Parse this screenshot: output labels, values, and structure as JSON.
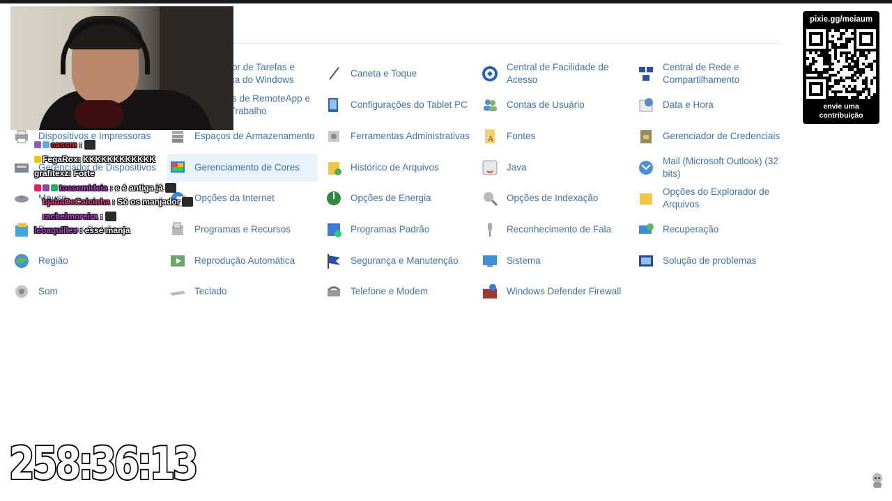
{
  "control_panel": {
    "items": [
      {
        "label": "Dispositivos e Impressoras",
        "icon": "printer-icon",
        "col": 0,
        "row": 2
      },
      {
        "label": "Gerenciador de Dispositivos",
        "icon": "device-manager-icon",
        "col": 0,
        "row": 3
      },
      {
        "label": "Mouse",
        "icon": "mouse-icon",
        "col": 0,
        "row": 4
      },
      {
        "label": "Programas Padrão",
        "icon": "folder-icon",
        "col": 0,
        "row": 5
      },
      {
        "label": "Região",
        "icon": "globe-clock-icon",
        "col": 0,
        "row": 6
      },
      {
        "label": "Som",
        "icon": "speaker-icon",
        "col": 0,
        "row": 7
      },
      {
        "label": "Agendador de Tarefas e Segurança do Windows",
        "icon": "task-icon",
        "col": 1,
        "row": 0
      },
      {
        "label": "Conexões de RemoteApp e Área de Trabalho",
        "icon": "remote-icon",
        "col": 1,
        "row": 1
      },
      {
        "label": "Espaços de Armazenamento",
        "icon": "storage-icon",
        "col": 1,
        "row": 2
      },
      {
        "label": "Gerenciamento de Cores",
        "icon": "color-management-icon",
        "col": 1,
        "row": 3,
        "highlight": true
      },
      {
        "label": "Opções da Internet",
        "icon": "internet-options-icon",
        "col": 1,
        "row": 4
      },
      {
        "label": "Programas e Recursos",
        "icon": "programs-icon",
        "col": 1,
        "row": 5
      },
      {
        "label": "Reprodução Automática",
        "icon": "autoplay-icon",
        "col": 1,
        "row": 6
      },
      {
        "label": "Teclado",
        "icon": "keyboard-icon",
        "col": 1,
        "row": 7
      },
      {
        "label": "Caneta e Toque",
        "icon": "pen-icon",
        "col": 2,
        "row": 0
      },
      {
        "label": "Configurações do Tablet PC",
        "icon": "tablet-icon",
        "col": 2,
        "row": 1
      },
      {
        "label": "Ferramentas Administrativas",
        "icon": "admin-tools-icon",
        "col": 2,
        "row": 2
      },
      {
        "label": "Histórico de Arquivos",
        "icon": "file-history-icon",
        "col": 2,
        "row": 3
      },
      {
        "label": "Opções de Energia",
        "icon": "power-icon",
        "col": 2,
        "row": 4
      },
      {
        "label": "Programas Padrão",
        "icon": "default-programs-icon",
        "col": 2,
        "row": 5
      },
      {
        "label": "Segurança e Manutenção",
        "icon": "flag-icon",
        "col": 2,
        "row": 6
      },
      {
        "label": "Telefone e Modem",
        "icon": "phone-icon",
        "col": 2,
        "row": 7
      },
      {
        "label": "Central de Facilidade de Acesso",
        "icon": "ease-of-access-icon",
        "col": 3,
        "row": 0
      },
      {
        "label": "Contas de Usuário",
        "icon": "users-icon",
        "col": 3,
        "row": 1
      },
      {
        "label": "Fontes",
        "icon": "fonts-icon",
        "col": 3,
        "row": 2
      },
      {
        "label": "Java",
        "icon": "java-icon",
        "col": 3,
        "row": 3
      },
      {
        "label": "Opções de Indexação",
        "icon": "indexing-icon",
        "col": 3,
        "row": 4
      },
      {
        "label": "Reconhecimento de Fala",
        "icon": "microphone-icon",
        "col": 3,
        "row": 5
      },
      {
        "label": "Sistema",
        "icon": "system-icon",
        "col": 3,
        "row": 6
      },
      {
        "label": "Windows Defender Firewall",
        "icon": "firewall-icon",
        "col": 3,
        "row": 7
      },
      {
        "label": "Central de Rede e Compartilhamento",
        "icon": "network-icon",
        "col": 4,
        "row": 0
      },
      {
        "label": "Data e Hora",
        "icon": "calendar-icon",
        "col": 4,
        "row": 1
      },
      {
        "label": "Gerenciador de Credenciais",
        "icon": "credentials-icon",
        "col": 4,
        "row": 2
      },
      {
        "label": "Mail (Microsoft Outlook) (32 bits)",
        "icon": "mail-icon",
        "col": 4,
        "row": 3
      },
      {
        "label": "Opções do Explorador de Arquivos",
        "icon": "explorer-options-icon",
        "col": 4,
        "row": 4
      },
      {
        "label": "Recuperação",
        "icon": "recovery-icon",
        "col": 4,
        "row": 5
      },
      {
        "label": "Solução de problemas",
        "icon": "troubleshoot-icon",
        "col": 4,
        "row": 6
      }
    ]
  },
  "chat": [
    {
      "user": "cassm",
      "user_color": "#e8323c",
      "sep": " :",
      "text": "",
      "badge_colors": [
        "#9b59b6",
        "#5dade2"
      ],
      "emote": true
    },
    {
      "user": "FegaRox",
      "user_color": "#ffffff",
      "sep": ":",
      "text": " KKKKKKKKKKKK",
      "badge_colors": [
        "#f1c40f"
      ]
    },
    {
      "user": "grafitexz",
      "user_color": "#ffffff",
      "sep": ":",
      "text": " Forte",
      "badge_colors": []
    },
    {
      "user": "tossemideia",
      "user_color": "#c13fd8",
      "sep": " :",
      "text": " e é antiga já",
      "badge_colors": [
        "#e91e63",
        "#8e44ad",
        "#27ae60"
      ],
      "emote": true
    },
    {
      "user": "bjabaDeCalcinha",
      "user_color": "#e84393",
      "sep": " :",
      "text": " Só os manjador",
      "badge_colors": [
        "#ffffff"
      ],
      "emote": true
    },
    {
      "user": "rachelmoreira",
      "user_color": "#c13fd8",
      "sep": " :",
      "text": "",
      "badge_colors": [
        "#ffffff"
      ],
      "emote": true
    },
    {
      "user": "leoaquilles",
      "user_color": "#c13fd8",
      "sep": " :",
      "text": " esse manja",
      "badge_colors": []
    }
  ],
  "donation": {
    "url": "pixie.gg/meiaum",
    "caption_line1": "envie uma",
    "caption_line2": "contribuição"
  },
  "timer": "258:36:13",
  "colors": {
    "link": "#1e5aa6",
    "highlight": "#e8f2fc"
  }
}
